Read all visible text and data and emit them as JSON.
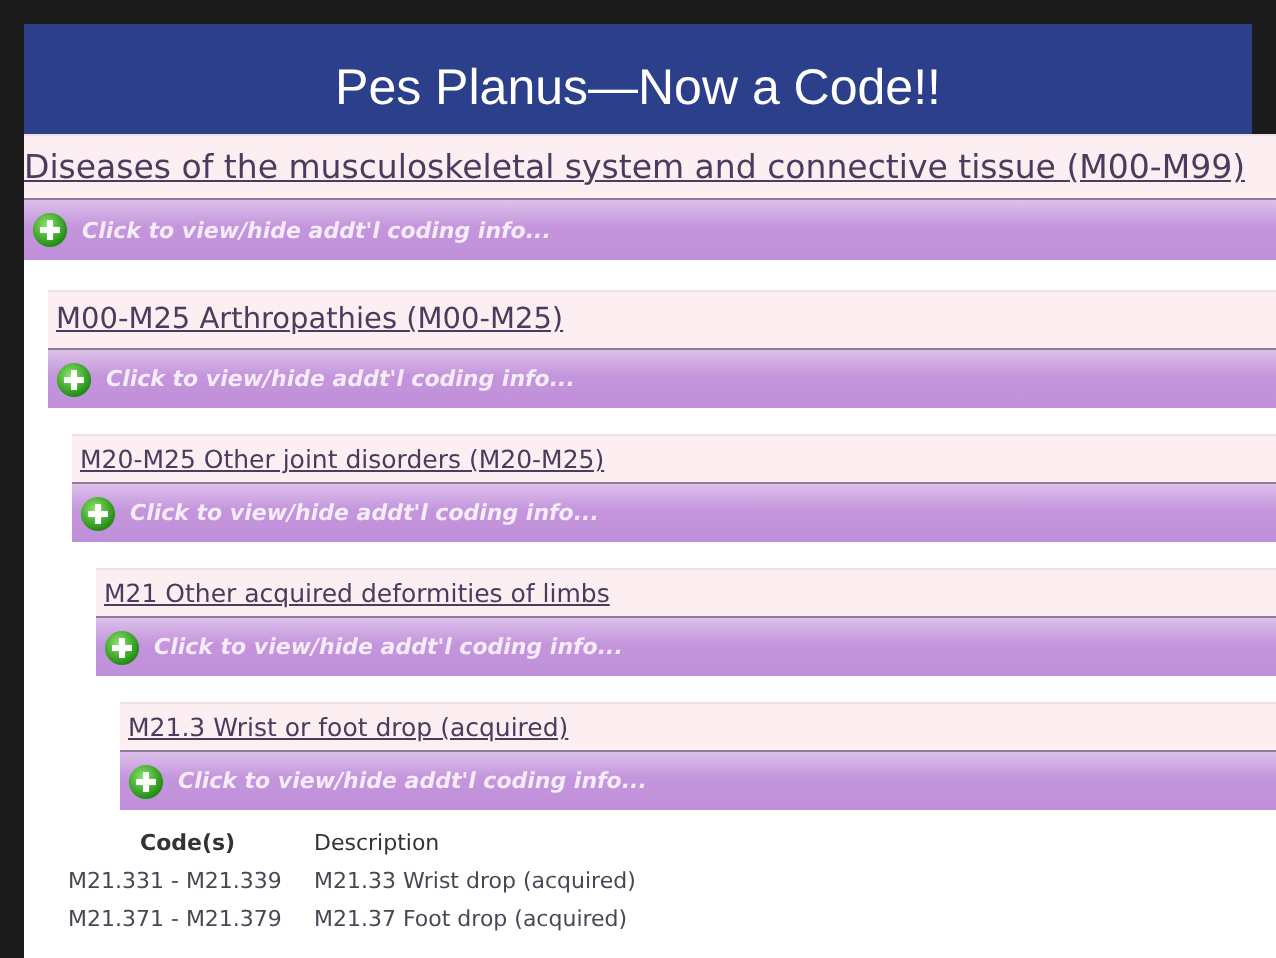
{
  "slide_title": "Pes Planus—Now a Code!!",
  "tree": [
    {
      "heading": "Diseases of the musculoskeletal system and connective tissue (M00-M99)",
      "toggle": "Click to view/hide addt'l coding info...",
      "children": [
        {
          "heading": "M00-M25 Arthropathies (M00-M25)",
          "toggle": "Click to view/hide addt'l coding info...",
          "children": [
            {
              "heading": "M20-M25 Other joint disorders (M20-M25)",
              "toggle": "Click to view/hide addt'l coding info...",
              "children": [
                {
                  "heading": "M21 Other acquired deformities of limbs",
                  "toggle": "Click to view/hide addt'l coding info...",
                  "children": [
                    {
                      "heading": "M21.3 Wrist or foot drop (acquired)",
                      "toggle": "Click to view/hide addt'l coding info..."
                    }
                  ]
                }
              ]
            }
          ]
        }
      ]
    }
  ],
  "table": {
    "columns": [
      "Code(s)",
      "Description"
    ],
    "rows": [
      [
        "M21.331  -  M21.339",
        "M21.33 Wrist drop (acquired)"
      ],
      [
        "M21.371  -  M21.379",
        "M21.37 Foot drop (acquired)"
      ]
    ]
  }
}
